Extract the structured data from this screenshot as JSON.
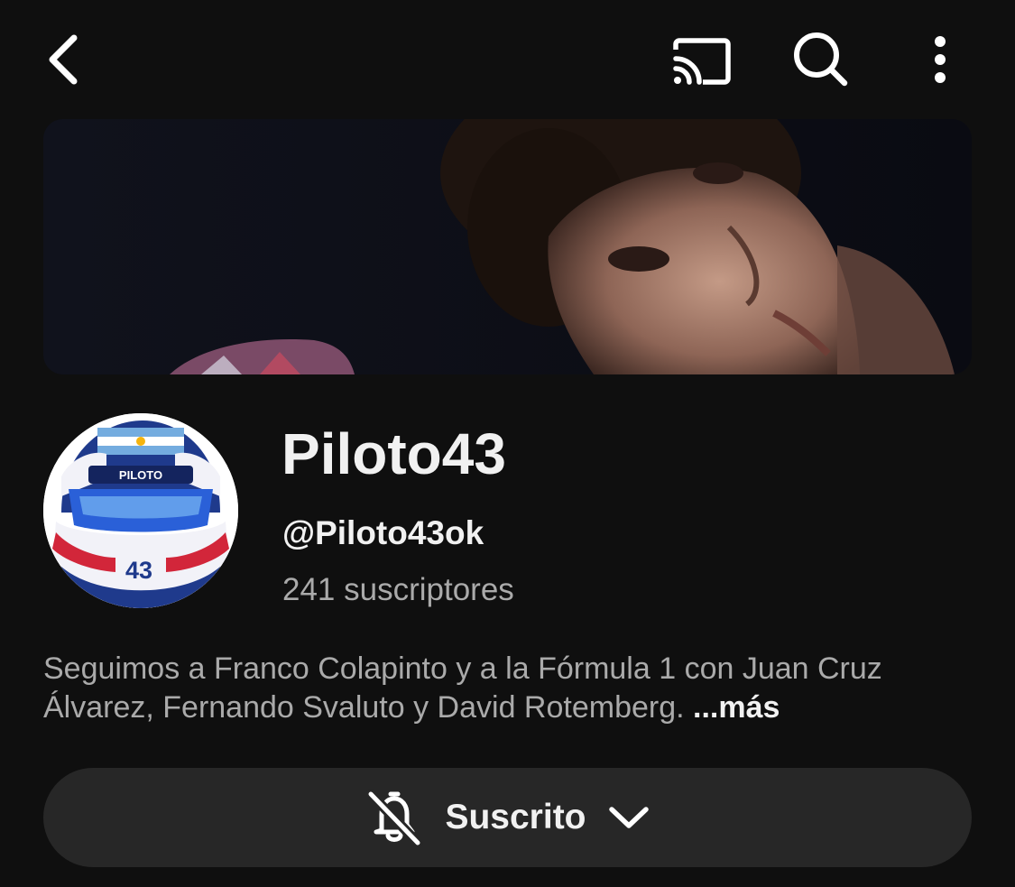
{
  "topbar": {
    "back_icon": "back-arrow-icon",
    "cast_icon": "cast-icon",
    "search_icon": "search-icon",
    "more_icon": "more-vertical-icon"
  },
  "channel": {
    "name": "Piloto43",
    "handle": "@Piloto43ok",
    "subscribers": "241 suscriptores",
    "avatar_helmet_text": "PILOTO",
    "avatar_number": "43",
    "description": "Seguimos a Franco Colapinto y a la Fórmula 1 con Juan Cruz Álvarez, Fernando Svaluto y David Rotemberg.",
    "more_label": "...más"
  },
  "subscribe": {
    "label": "Suscrito",
    "bell_icon": "bell-off-icon",
    "chevron_icon": "chevron-down-icon"
  },
  "colors": {
    "background": "#0f0f0f",
    "button_bg": "#272727",
    "primary_text": "#f1f1f1",
    "secondary_text": "#aaaaaa"
  }
}
